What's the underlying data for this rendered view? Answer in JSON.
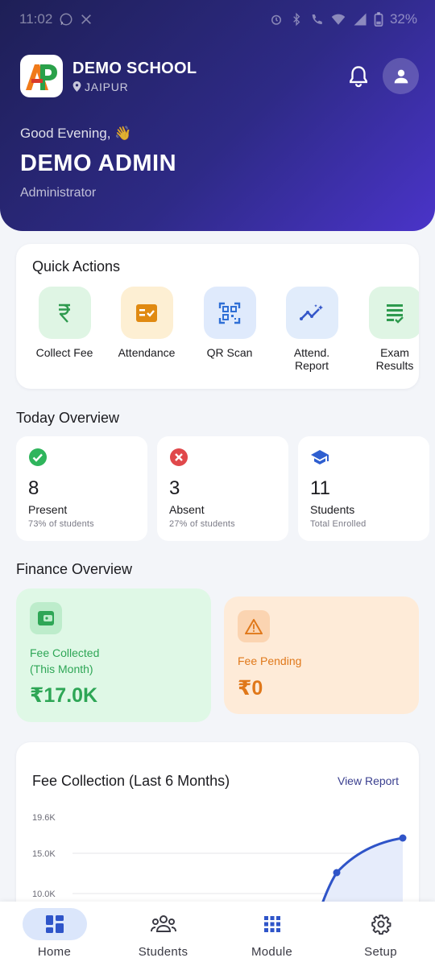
{
  "status_bar": {
    "time": "11:02",
    "left_icons": [
      "whatsapp-icon",
      "x-icon"
    ],
    "right_icons": [
      "alarm-icon",
      "bluetooth-icon",
      "wifi-calling-icon",
      "wifi-icon",
      "signal-icon",
      "battery-icon"
    ],
    "battery": "32%"
  },
  "header": {
    "logo_text": "AP",
    "school_name": "DEMO SCHOOL",
    "city": "JAIPUR",
    "greeting": "Good Evening, 👋",
    "user_name": "DEMO ADMIN",
    "role": "Administrator",
    "colors": {
      "gradient_start": "#1e1f56",
      "gradient_end": "#4a34c9"
    }
  },
  "quick_actions": {
    "title": "Quick Actions",
    "items": [
      {
        "label": "Collect Fee",
        "icon": "rupee-icon",
        "bg": "#dff5e4",
        "color": "#2e9a4e"
      },
      {
        "label": "Attendance",
        "icon": "attendance-icon",
        "bg": "#fdefd3",
        "color": "#e08a12"
      },
      {
        "label": "QR Scan",
        "icon": "qr-scan-icon",
        "bg": "#dfeafc",
        "color": "#2f6fd6"
      },
      {
        "label": "Attend. Report",
        "icon": "analytics-icon",
        "bg": "#e1ecfb",
        "color": "#3457c9"
      },
      {
        "label": "Exam Results",
        "icon": "results-icon",
        "bg": "#dff5e4",
        "color": "#2e9a4e"
      }
    ]
  },
  "today_overview": {
    "title": "Today Overview",
    "cards": [
      {
        "value": "8",
        "label": "Present",
        "sub": "73% of students",
        "icon": "check-circle-icon",
        "color": "#2fb55c"
      },
      {
        "value": "3",
        "label": "Absent",
        "sub": "27% of students",
        "icon": "cancel-circle-icon",
        "color": "#e0484b"
      },
      {
        "value": "11",
        "label": "Students",
        "sub": "Total Enrolled",
        "icon": "graduation-cap-icon",
        "color": "#2f5fd0"
      }
    ]
  },
  "finance_overview": {
    "title": "Finance Overview",
    "collected": {
      "label_line1": "Fee Collected",
      "label_line2": "(This Month)",
      "value": "₹17.0K",
      "icon": "wallet-icon",
      "color": "#2ea656"
    },
    "pending": {
      "label": "Fee Pending",
      "value": "₹0",
      "icon": "warning-icon",
      "color": "#e0781a"
    }
  },
  "fee_chart": {
    "title": "Fee Collection (Last 6 Months)",
    "action": "View Report"
  },
  "chart_data": {
    "type": "area",
    "title": "Fee Collection (Last 6 Months)",
    "y_ticks": [
      "19.6K",
      "15.0K",
      "10.0K"
    ],
    "visible_points": [
      {
        "y": 12.6
      },
      {
        "y": 16.9
      }
    ],
    "line_color": "#2f54c8",
    "fill_color": "#e6ecfb",
    "grid": true
  },
  "bottom_nav": {
    "items": [
      {
        "label": "Home",
        "icon": "dashboard-icon",
        "active": true
      },
      {
        "label": "Students",
        "icon": "people-icon",
        "active": false
      },
      {
        "label": "Module",
        "icon": "grid-icon",
        "active": false
      },
      {
        "label": "Setup",
        "icon": "settings-icon",
        "active": false
      }
    ]
  }
}
